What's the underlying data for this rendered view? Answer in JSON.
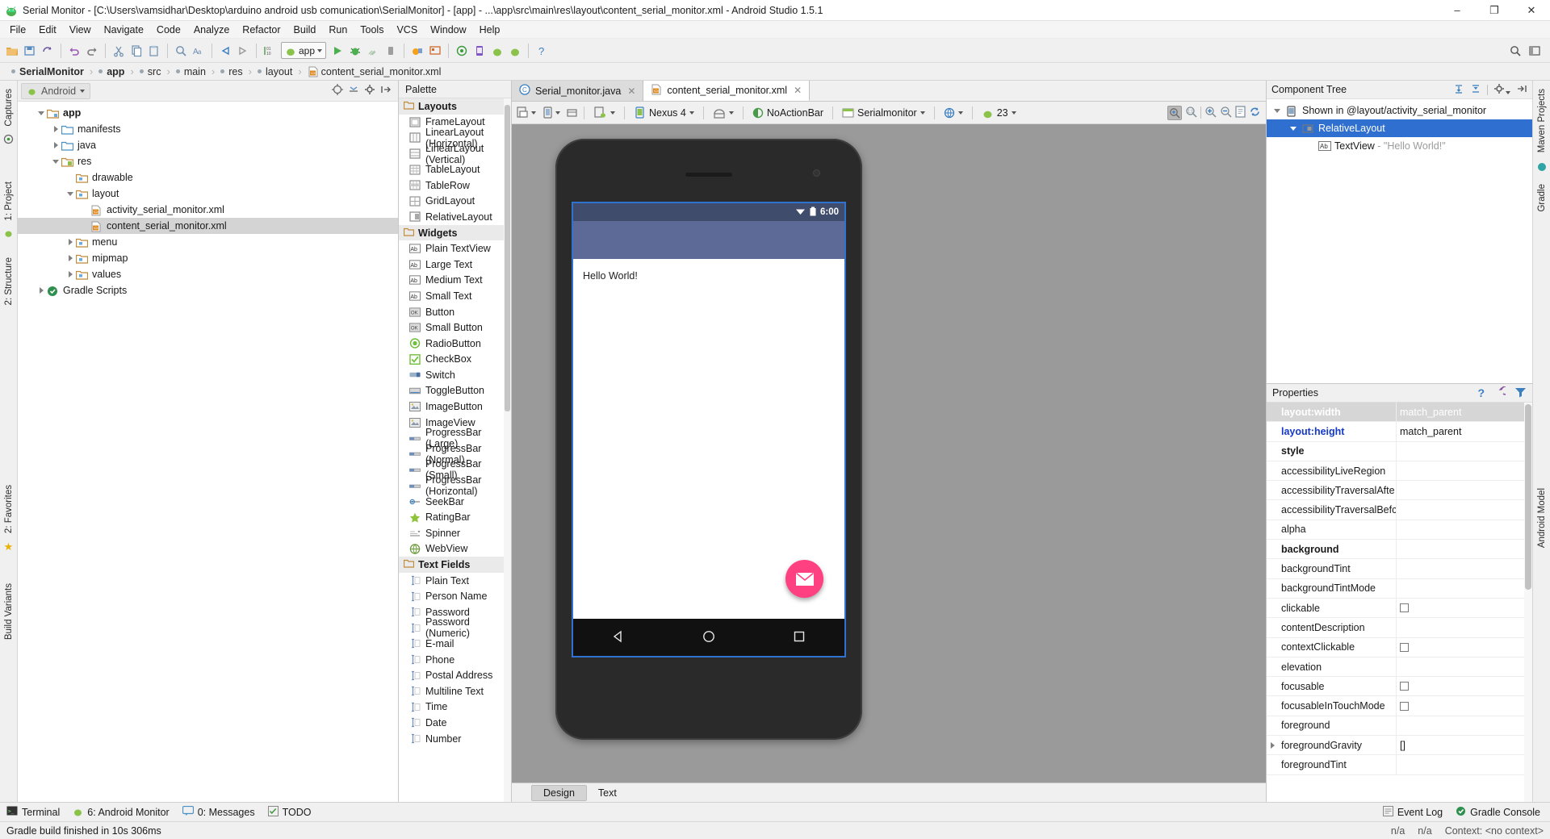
{
  "window": {
    "title": "Serial Monitor - [C:\\Users\\vamsidhar\\Desktop\\arduino android usb comunication\\SerialMonitor] - [app] - ...\\app\\src\\main\\res\\layout\\content_serial_monitor.xml - Android Studio 1.5.1",
    "minimize": "–",
    "maximize": "❐",
    "close": "✕"
  },
  "menubar": [
    "File",
    "Edit",
    "View",
    "Navigate",
    "Code",
    "Analyze",
    "Refactor",
    "Build",
    "Run",
    "Tools",
    "VCS",
    "Window",
    "Help"
  ],
  "toolbar": {
    "module": "app"
  },
  "breadcrumb": [
    {
      "label": "SerialMonitor",
      "bold": true,
      "icon": "dot"
    },
    {
      "label": "app",
      "bold": true,
      "icon": "dot"
    },
    {
      "label": "src",
      "bold": false,
      "icon": "dot"
    },
    {
      "label": "main",
      "bold": false,
      "icon": "dot"
    },
    {
      "label": "res",
      "bold": false,
      "icon": "dot"
    },
    {
      "label": "layout",
      "bold": false,
      "icon": "dot"
    },
    {
      "label": "content_serial_monitor.xml",
      "bold": false,
      "icon": "xml"
    }
  ],
  "left_strip": [
    "Captures",
    "1: Project",
    "2: Structure",
    "2: Favorites",
    "Build Variants"
  ],
  "right_strip": [
    "Maven Projects",
    "Gradle",
    "Android Model"
  ],
  "project_panel": {
    "selector": "Android",
    "tree": [
      {
        "label": "app",
        "depth": 0,
        "twisty": "down",
        "icon": "module",
        "bold": true,
        "selected": false
      },
      {
        "label": "manifests",
        "depth": 1,
        "twisty": "right",
        "icon": "folder-blue",
        "bold": false,
        "selected": false
      },
      {
        "label": "java",
        "depth": 1,
        "twisty": "right",
        "icon": "folder-blue",
        "bold": false,
        "selected": false
      },
      {
        "label": "res",
        "depth": 1,
        "twisty": "down",
        "icon": "folder-res",
        "bold": false,
        "selected": false
      },
      {
        "label": "drawable",
        "depth": 2,
        "twisty": "none",
        "icon": "folder-tan",
        "bold": false,
        "selected": false
      },
      {
        "label": "layout",
        "depth": 2,
        "twisty": "down",
        "icon": "folder-tan",
        "bold": false,
        "selected": false
      },
      {
        "label": "activity_serial_monitor.xml",
        "depth": 3,
        "twisty": "none",
        "icon": "xml",
        "bold": false,
        "selected": false
      },
      {
        "label": "content_serial_monitor.xml",
        "depth": 3,
        "twisty": "none",
        "icon": "xml",
        "bold": false,
        "selected": true
      },
      {
        "label": "menu",
        "depth": 2,
        "twisty": "right",
        "icon": "folder-tan",
        "bold": false,
        "selected": false
      },
      {
        "label": "mipmap",
        "depth": 2,
        "twisty": "right",
        "icon": "folder-tan",
        "bold": false,
        "selected": false
      },
      {
        "label": "values",
        "depth": 2,
        "twisty": "right",
        "icon": "folder-tan",
        "bold": false,
        "selected": false
      },
      {
        "label": "Gradle Scripts",
        "depth": 0,
        "twisty": "right",
        "icon": "gradle",
        "bold": false,
        "selected": false
      }
    ]
  },
  "palette": {
    "title": "Palette",
    "groups": [
      {
        "name": "Layouts",
        "items": [
          {
            "label": "FrameLayout",
            "icon": "frame"
          },
          {
            "label": "LinearLayout (Horizontal)",
            "icon": "linear-h"
          },
          {
            "label": "LinearLayout (Vertical)",
            "icon": "linear-v"
          },
          {
            "label": "TableLayout",
            "icon": "table"
          },
          {
            "label": "TableRow",
            "icon": "tablerow"
          },
          {
            "label": "GridLayout",
            "icon": "grid"
          },
          {
            "label": "RelativeLayout",
            "icon": "relative"
          }
        ]
      },
      {
        "name": "Widgets",
        "items": [
          {
            "label": "Plain TextView",
            "icon": "ab"
          },
          {
            "label": "Large Text",
            "icon": "ab"
          },
          {
            "label": "Medium Text",
            "icon": "ab"
          },
          {
            "label": "Small Text",
            "icon": "ab"
          },
          {
            "label": "Button",
            "icon": "ok"
          },
          {
            "label": "Small Button",
            "icon": "ok"
          },
          {
            "label": "RadioButton",
            "icon": "radio"
          },
          {
            "label": "CheckBox",
            "icon": "check"
          },
          {
            "label": "Switch",
            "icon": "switch"
          },
          {
            "label": "ToggleButton",
            "icon": "toggle"
          },
          {
            "label": "ImageButton",
            "icon": "image"
          },
          {
            "label": "ImageView",
            "icon": "image"
          },
          {
            "label": "ProgressBar (Large)",
            "icon": "progress"
          },
          {
            "label": "ProgressBar (Normal)",
            "icon": "progress"
          },
          {
            "label": "ProgressBar (Small)",
            "icon": "progress"
          },
          {
            "label": "ProgressBar (Horizontal)",
            "icon": "progress"
          },
          {
            "label": "SeekBar",
            "icon": "seek"
          },
          {
            "label": "RatingBar",
            "icon": "star"
          },
          {
            "label": "Spinner",
            "icon": "spinner"
          },
          {
            "label": "WebView",
            "icon": "web"
          }
        ]
      },
      {
        "name": "Text Fields",
        "items": [
          {
            "label": "Plain Text",
            "icon": "field"
          },
          {
            "label": "Person Name",
            "icon": "field"
          },
          {
            "label": "Password",
            "icon": "field"
          },
          {
            "label": "Password (Numeric)",
            "icon": "field"
          },
          {
            "label": "E-mail",
            "icon": "field"
          },
          {
            "label": "Phone",
            "icon": "field"
          },
          {
            "label": "Postal Address",
            "icon": "field"
          },
          {
            "label": "Multiline Text",
            "icon": "field"
          },
          {
            "label": "Time",
            "icon": "field"
          },
          {
            "label": "Date",
            "icon": "field"
          },
          {
            "label": "Number",
            "icon": "field"
          }
        ]
      }
    ]
  },
  "editor": {
    "tabs": [
      {
        "label": "Serial_monitor.java",
        "icon": "java",
        "active": false
      },
      {
        "label": "content_serial_monitor.xml",
        "icon": "xml",
        "active": true
      }
    ],
    "design_toolbar": {
      "device": "Nexus 4",
      "theme": "NoActionBar",
      "activity": "Serialmonitor",
      "api": "23"
    },
    "bottom_tabs": [
      {
        "label": "Design",
        "active": true
      },
      {
        "label": "Text",
        "active": false
      }
    ]
  },
  "preview": {
    "status_time": "6:00",
    "hello_text": "Hello World!",
    "fab_icon": "mail-icon",
    "nav": [
      "back-triangle",
      "home-circle",
      "recents-square"
    ],
    "colors": {
      "statusbar": "#3f4c6b",
      "appbar": "#5d6a97",
      "fab": "#ff4081",
      "canvas_bg": "#9a9a9a"
    }
  },
  "component_tree": {
    "title": "Component Tree",
    "nodes": [
      {
        "label": "Shown in @layout/activity_serial_monitor",
        "depth": 0,
        "twisty": "down",
        "icon": "device",
        "selected": false,
        "suffix": ""
      },
      {
        "label": "RelativeLayout",
        "depth": 1,
        "twisty": "down",
        "icon": "relative",
        "selected": true,
        "suffix": ""
      },
      {
        "label": "TextView",
        "depth": 2,
        "twisty": "none",
        "icon": "ab",
        "selected": false,
        "suffix": " - \"Hello World!\""
      }
    ]
  },
  "properties": {
    "title": "Properties",
    "rows": [
      {
        "name": "layout:width",
        "value": "match_parent",
        "style": "selected",
        "control": "text"
      },
      {
        "name": "layout:height",
        "value": "match_parent",
        "style": "blue",
        "control": "text"
      },
      {
        "name": "style",
        "value": "",
        "style": "bold",
        "control": "text"
      },
      {
        "name": "accessibilityLiveRegion",
        "value": "",
        "style": "plain",
        "control": "text"
      },
      {
        "name": "accessibilityTraversalAfte",
        "value": "",
        "style": "plain",
        "control": "text"
      },
      {
        "name": "accessibilityTraversalBefc",
        "value": "",
        "style": "plain",
        "control": "text"
      },
      {
        "name": "alpha",
        "value": "",
        "style": "plain",
        "control": "text"
      },
      {
        "name": "background",
        "value": "",
        "style": "bold",
        "control": "text"
      },
      {
        "name": "backgroundTint",
        "value": "",
        "style": "plain",
        "control": "text"
      },
      {
        "name": "backgroundTintMode",
        "value": "",
        "style": "plain",
        "control": "text"
      },
      {
        "name": "clickable",
        "value": "",
        "style": "plain",
        "control": "checkbox"
      },
      {
        "name": "contentDescription",
        "value": "",
        "style": "plain",
        "control": "text"
      },
      {
        "name": "contextClickable",
        "value": "",
        "style": "plain",
        "control": "checkbox"
      },
      {
        "name": "elevation",
        "value": "",
        "style": "plain",
        "control": "text"
      },
      {
        "name": "focusable",
        "value": "",
        "style": "plain",
        "control": "checkbox"
      },
      {
        "name": "focusableInTouchMode",
        "value": "",
        "style": "plain",
        "control": "checkbox"
      },
      {
        "name": "foreground",
        "value": "",
        "style": "plain",
        "control": "text"
      },
      {
        "name": "foregroundGravity",
        "value": "[]",
        "style": "plain",
        "control": "text",
        "expandable": true
      },
      {
        "name": "foregroundTint",
        "value": "",
        "style": "plain",
        "control": "text"
      }
    ]
  },
  "toolwindow_bar": {
    "left": [
      {
        "label": "Terminal",
        "icon": "terminal-icon"
      },
      {
        "label": "6: Android Monitor",
        "icon": "android-icon"
      },
      {
        "label": "0: Messages",
        "icon": "messages-icon"
      },
      {
        "label": "TODO",
        "icon": "todo-icon"
      }
    ],
    "right": [
      {
        "label": "Event Log",
        "icon": "eventlog-icon"
      },
      {
        "label": "Gradle Console",
        "icon": "gradle-icon"
      }
    ]
  },
  "statusbar": {
    "message": "Gradle build finished in 10s 306ms",
    "position": "n/a",
    "lineend": "n/a",
    "context": "Context: <no context>"
  }
}
